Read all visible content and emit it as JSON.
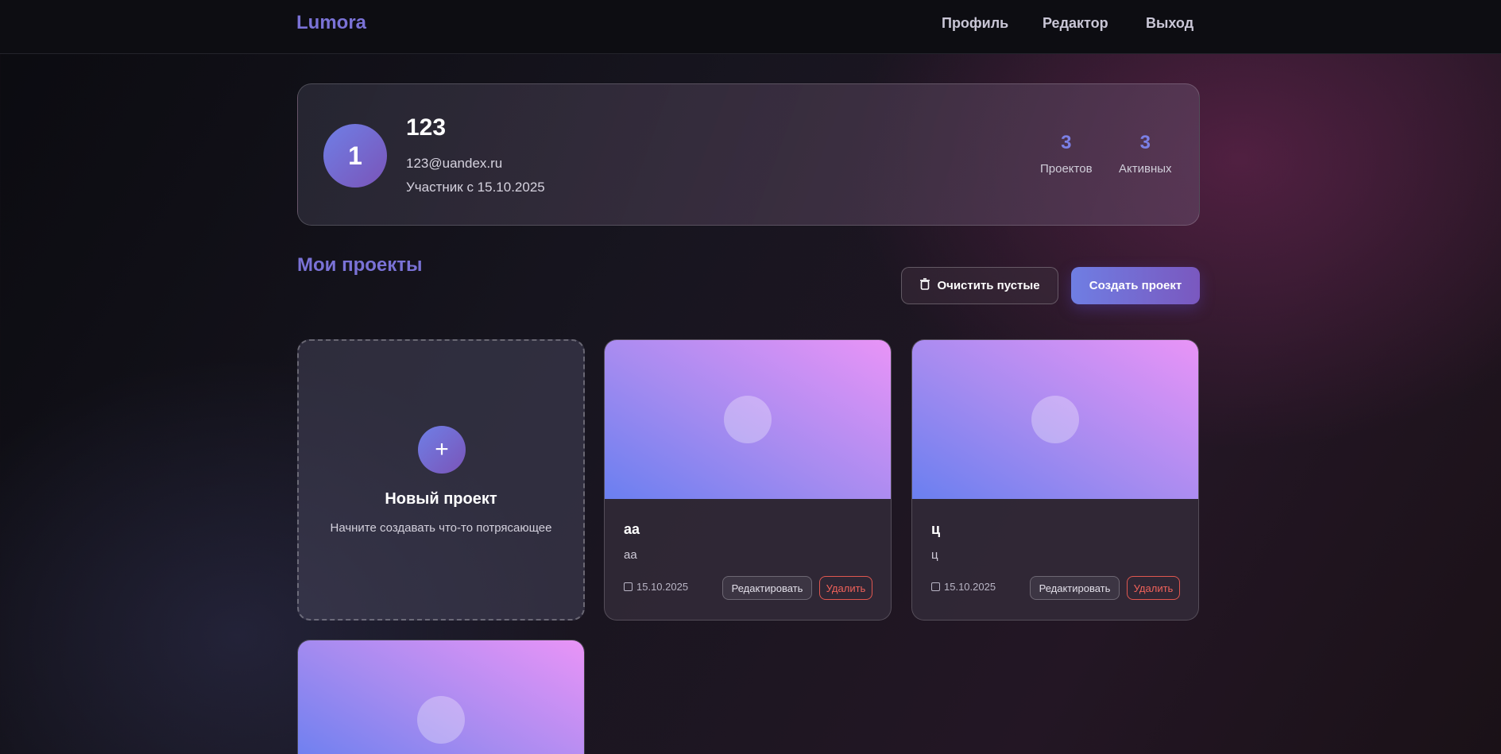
{
  "app": {
    "logo": "Lumora"
  },
  "nav": {
    "profile": "Профиль",
    "editor": "Редактор",
    "logout": "Выход"
  },
  "profile": {
    "avatar_letter": "1",
    "name": "123",
    "email": "123@uandex.ru",
    "since": "Участник с 15.10.2025",
    "stats": [
      {
        "value": "3",
        "label": "Проектов"
      },
      {
        "value": "3",
        "label": "Активных"
      }
    ]
  },
  "projects_section": {
    "title": "Мои проекты",
    "clear_label": "Очистить пустые",
    "create_label": "Создать проект"
  },
  "new_project": {
    "plus": "+",
    "title": "Новый проект",
    "subtitle": "Начните создавать что-то потрясающее"
  },
  "projects": [
    {
      "name": "аа",
      "desc": "аа",
      "date": "15.10.2025",
      "edit": "Редактировать",
      "delete": "Удалить"
    },
    {
      "name": "ц",
      "desc": "ц",
      "date": "15.10.2025",
      "edit": "Редактировать",
      "delete": "Удалить"
    }
  ],
  "colors": {
    "accent": "#7a72d6",
    "danger": "#f0625a",
    "cover_gradient_start": "#6a7ff0",
    "cover_gradient_end": "#e994f7"
  }
}
